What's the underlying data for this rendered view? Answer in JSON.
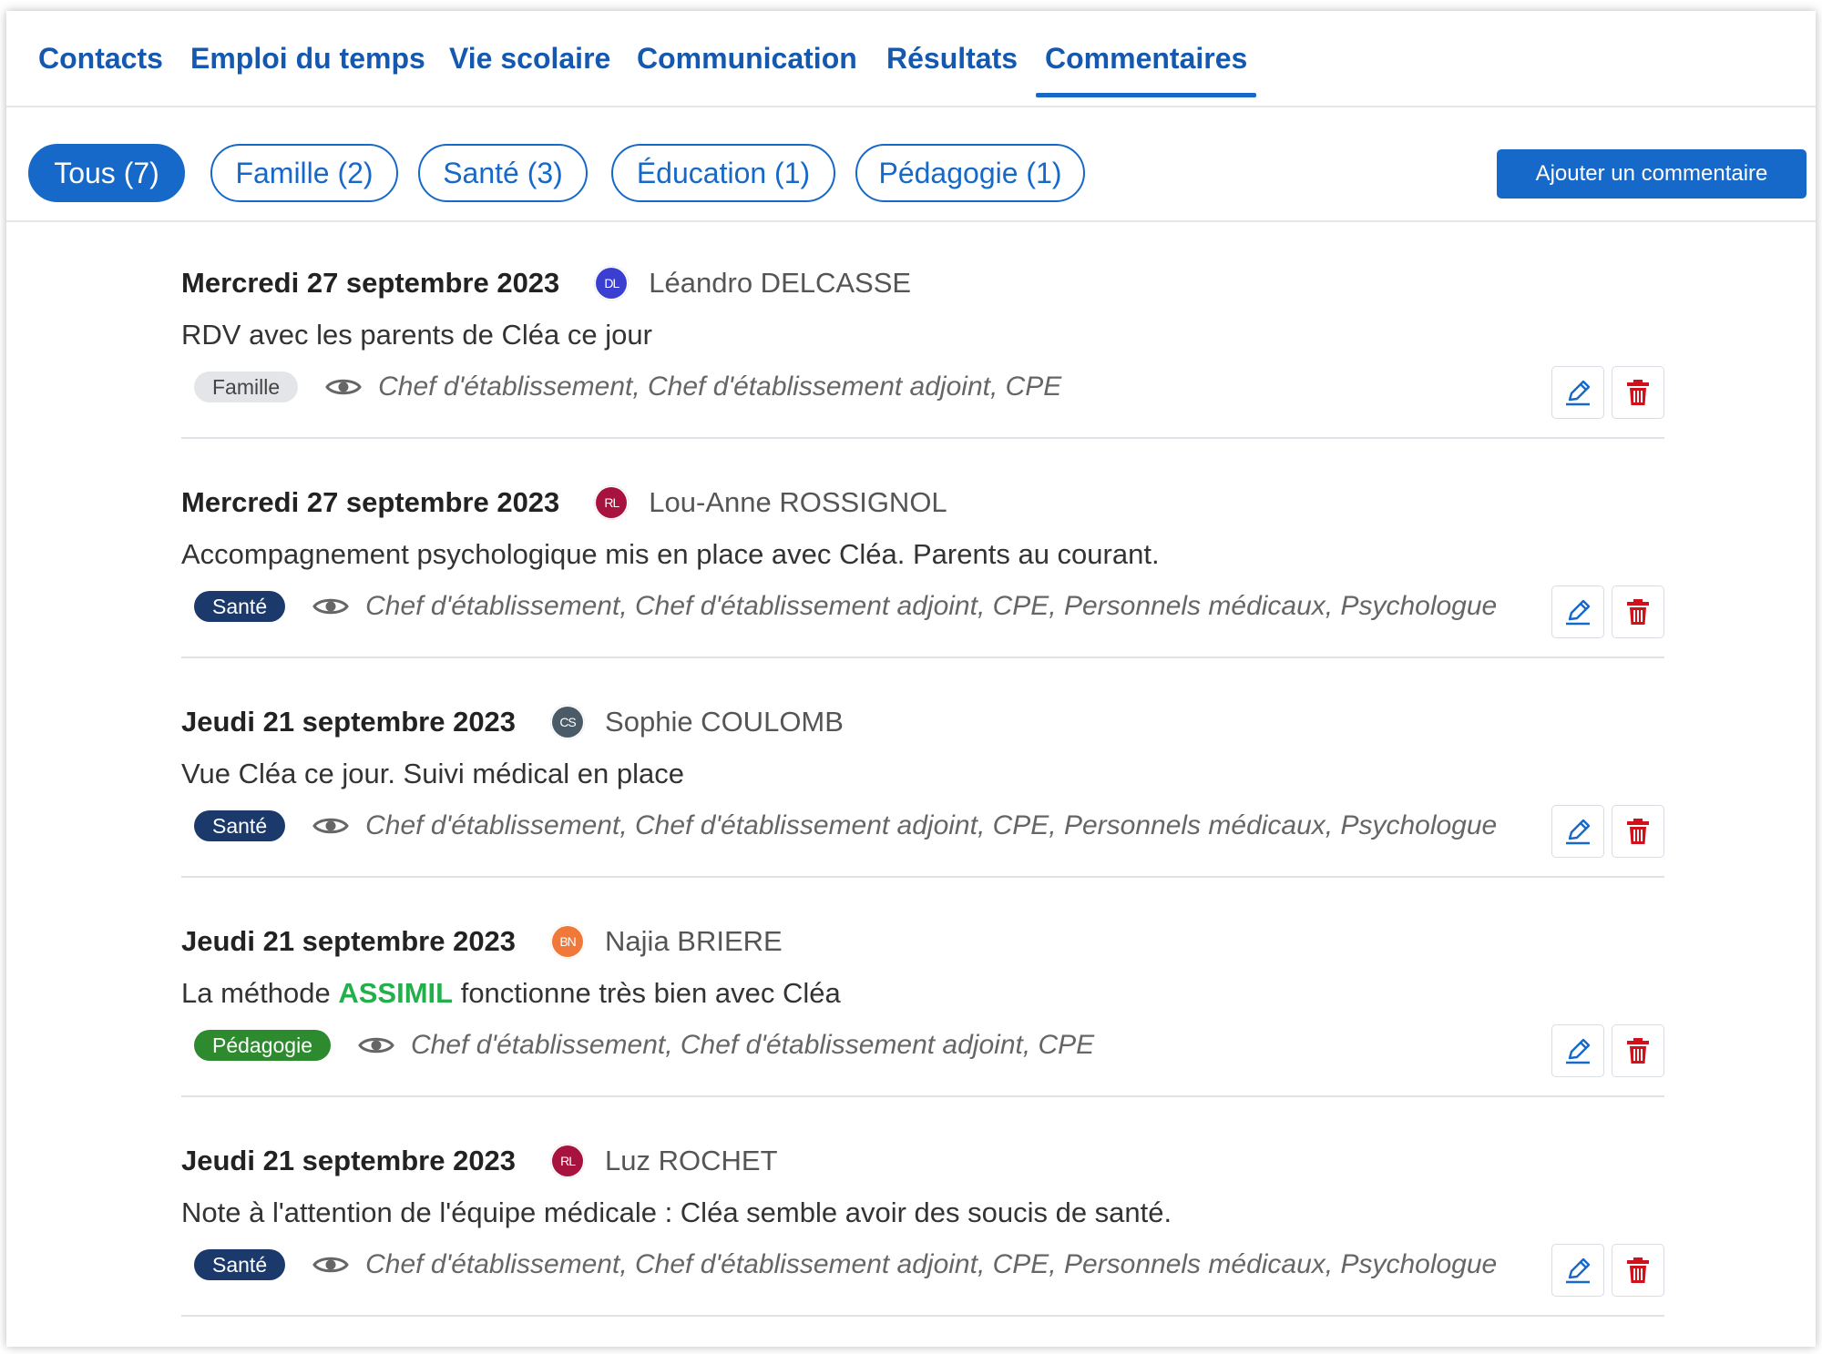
{
  "tabs": [
    {
      "label": "Contacts",
      "active": false
    },
    {
      "label": "Emploi du temps",
      "active": false
    },
    {
      "label": "Vie scolaire",
      "active": false
    },
    {
      "label": "Communication",
      "active": false
    },
    {
      "label": "Résultats",
      "active": false
    },
    {
      "label": "Commentaires",
      "active": true
    }
  ],
  "filters": [
    {
      "label": "Tous (7)",
      "active": true
    },
    {
      "label": "Famille (2)",
      "active": false
    },
    {
      "label": "Santé (3)",
      "active": false
    },
    {
      "label": "Éducation (1)",
      "active": false
    },
    {
      "label": "Pédagogie (1)",
      "active": false
    }
  ],
  "add_button_label": "Ajouter un commentaire",
  "colors": {
    "accent": "#1769c9",
    "tag_famille_bg": "#e3e5e8",
    "tag_sante_bg": "#1b3a6b",
    "tag_pedagogie_bg": "#2e8a2e",
    "delete_red": "#d0101b",
    "edit_blue": "#1769c9"
  },
  "comments": [
    {
      "date": "Mercredi 27 septembre 2023",
      "avatar_initials": "DL",
      "avatar_color": "#3b3fd1",
      "author": "Léandro DELCASSE",
      "text": "RDV avec les parents de Cléa ce jour",
      "text_before": "",
      "text_highlight": "",
      "text_after": "",
      "tag": "Famille",
      "tag_bg": "#e3e5e8",
      "tag_fg": "#444444",
      "visibility": "Chef d'établissement, Chef d'établissement adjoint, CPE"
    },
    {
      "date": "Mercredi 27 septembre 2023",
      "avatar_initials": "RL",
      "avatar_color": "#a8123e",
      "author": "Lou-Anne ROSSIGNOL",
      "text": "Accompagnement psychologique mis en place avec Cléa. Parents au courant.",
      "text_before": "",
      "text_highlight": "",
      "text_after": "",
      "tag": "Santé",
      "tag_bg": "#1b3a6b",
      "tag_fg": "#ffffff",
      "visibility": "Chef d'établissement, Chef d'établissement adjoint, CPE, Personnels médicaux, Psychologue"
    },
    {
      "date": "Jeudi 21 septembre 2023",
      "avatar_initials": "CS",
      "avatar_color": "#4a5a66",
      "author": "Sophie COULOMB",
      "text": "Vue Cléa ce jour. Suivi médical en place",
      "text_before": "",
      "text_highlight": "",
      "text_after": "",
      "tag": "Santé",
      "tag_bg": "#1b3a6b",
      "tag_fg": "#ffffff",
      "visibility": "Chef d'établissement, Chef d'établissement adjoint, CPE, Personnels médicaux, Psychologue"
    },
    {
      "date": "Jeudi 21 septembre 2023",
      "avatar_initials": "BN",
      "avatar_color": "#f07838",
      "author": "Najia BRIERE",
      "text": "",
      "text_before": "La méthode ",
      "text_highlight": "ASSIMIL",
      "text_after": " fonctionne très bien avec Cléa",
      "tag": "Pédagogie",
      "tag_bg": "#2e8a2e",
      "tag_fg": "#ffffff",
      "visibility": "Chef d'établissement, Chef d'établissement adjoint, CPE"
    },
    {
      "date": "Jeudi 21 septembre 2023",
      "avatar_initials": "RL",
      "avatar_color": "#a8123e",
      "author": "Luz ROCHET",
      "text": "Note à l'attention de l'équipe médicale : Cléa semble avoir des soucis de santé.",
      "text_before": "",
      "text_highlight": "",
      "text_after": "",
      "tag": "Santé",
      "tag_bg": "#1b3a6b",
      "tag_fg": "#ffffff",
      "visibility": "Chef d'établissement, Chef d'établissement adjoint, CPE, Personnels médicaux, Psychologue"
    }
  ],
  "icons": {
    "visibility": "eye-icon",
    "edit": "pencil-icon",
    "delete": "trash-icon"
  }
}
